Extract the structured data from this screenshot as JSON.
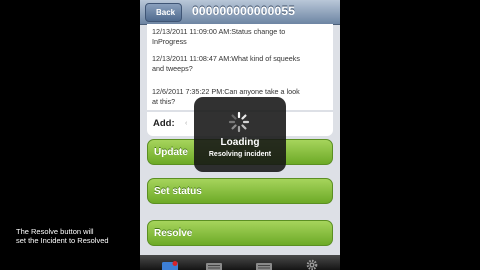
{
  "caption": {
    "line1": "The Resolve button will",
    "line2": "set the Incident to Resolved"
  },
  "navbar": {
    "back_label": "Back",
    "title": "000000000000055"
  },
  "comments": [
    {
      "line1": "12/13/2011 11:09:00 AM:Status change to",
      "line2": "InProgress"
    },
    {
      "line1": "12/13/2011 11:08:47 AM:What kind of squeeks",
      "line2": "and tweeps?"
    },
    {
      "line1": "12/6/2011 7:35:22 PM:Can anyone take a look",
      "line2": "at this?"
    }
  ],
  "add_row": {
    "label": "Add:"
  },
  "buttons": {
    "update": "Update",
    "set_status": "Set status",
    "resolve": "Resolve"
  },
  "loading": {
    "title": "Loading",
    "subtitle": "Resolving incident"
  },
  "tabbar": {
    "icons": [
      "incidents-icon",
      "queue-icon",
      "list-icon",
      "settings-icon"
    ],
    "active_color": "#3d7fd6",
    "badge_color": "#d8232a"
  },
  "colors": {
    "navbar": "#6d85a3",
    "button_green": "#7dbb33"
  }
}
